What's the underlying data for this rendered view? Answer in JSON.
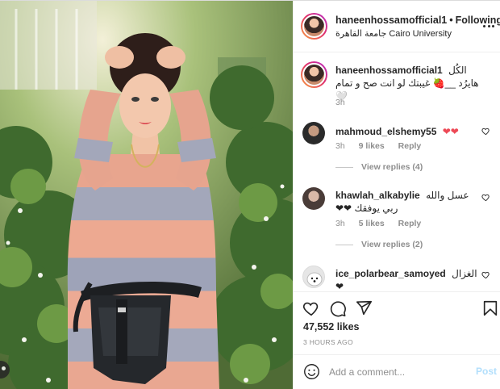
{
  "post": {
    "username": "haneenhossamofficial1",
    "follow_label": "Following",
    "location": "جامعة القاهرة Cairo University",
    "caption": "الكُل هايرُد __🍓 غيبتك لو انت صح و تمام 🤍",
    "caption_time": "3h"
  },
  "comments": [
    {
      "username": "mahmoud_elshemy55",
      "text": "❤❤",
      "time": "3h",
      "likes": "9 likes",
      "reply": "Reply",
      "view_replies": "View replies (4)"
    },
    {
      "username": "khawlah_alkabylie",
      "text": "عسل والله ربي يوفقك ❤❤",
      "time": "3h",
      "likes": "5 likes",
      "reply": "Reply",
      "view_replies": "View replies (2)"
    },
    {
      "username": "ice_polarbear_samoyed",
      "text": "الغزال ❤"
    }
  ],
  "actions": {
    "likes": "47,552 likes",
    "time_ago": "3 HOURS AGO",
    "comment_placeholder": "Add a comment...",
    "post_label": "Post"
  },
  "icons": [
    "more-icon",
    "heart-icon",
    "comment-icon",
    "share-icon",
    "bookmark-icon",
    "smile-icon"
  ],
  "colors": {
    "accent_red": "#ed4956",
    "post_disabled": "#b2dffc",
    "secondary_text": "#8e8e8e"
  }
}
